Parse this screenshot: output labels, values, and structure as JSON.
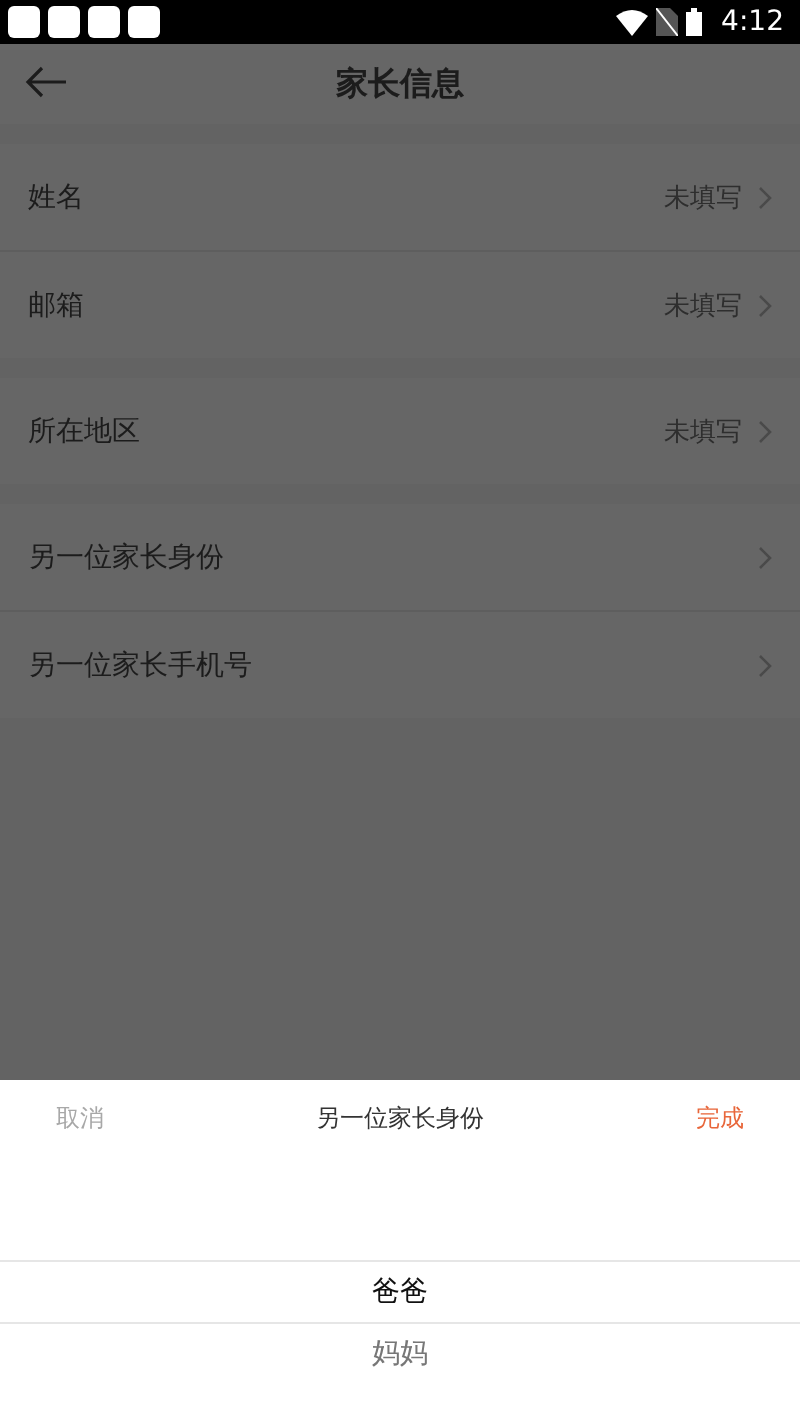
{
  "status_bar": {
    "time": "4:12"
  },
  "header": {
    "title": "家长信息"
  },
  "sections": [
    {
      "rows": [
        {
          "label": "姓名",
          "value": "未填写"
        },
        {
          "label": "邮箱",
          "value": "未填写"
        }
      ]
    },
    {
      "rows": [
        {
          "label": "所在地区",
          "value": "未填写"
        }
      ]
    },
    {
      "rows": [
        {
          "label": "另一位家长身份"
        },
        {
          "label": "另一位家长手机号"
        }
      ]
    }
  ],
  "picker": {
    "cancel": "取消",
    "title": "另一位家长身份",
    "done": "完成",
    "options": [
      {
        "label": "爸爸",
        "selected": true
      },
      {
        "label": "妈妈",
        "selected": false
      }
    ]
  }
}
